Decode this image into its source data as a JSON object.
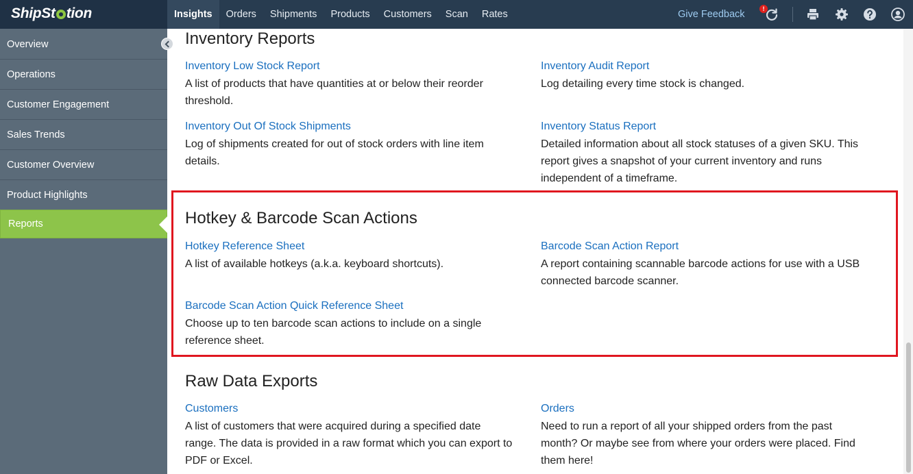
{
  "app": {
    "logo_left": "ShipSt",
    "logo_right": "tion"
  },
  "nav": {
    "items": [
      "Insights",
      "Orders",
      "Shipments",
      "Products",
      "Customers",
      "Scan",
      "Rates"
    ],
    "feedback": "Give Feedback",
    "notification_count": "!"
  },
  "sidebar": {
    "items": [
      "Overview",
      "Operations",
      "Customer Engagement",
      "Sales Trends",
      "Customer Overview",
      "Product Highlights",
      "Reports"
    ],
    "active": "Reports"
  },
  "sections": {
    "inventory": {
      "title": "Inventory Reports",
      "reports": [
        {
          "title": "Inventory Low Stock Report",
          "desc_lines": [
            "A list of products that have quantities at or below their reorder",
            "threshold."
          ]
        },
        {
          "title": "Inventory Audit Report",
          "desc_lines": [
            "Log detailing every time stock is changed."
          ]
        },
        {
          "title": "Inventory Out Of Stock Shipments",
          "desc_lines": [
            "Log of shipments created for out of stock orders with line item",
            "details."
          ]
        },
        {
          "title": "Inventory Status Report",
          "desc_lines": [
            "Detailed information about all stock statuses of a given SKU. This",
            "report gives a snapshot of your current inventory and runs",
            "independent of a timeframe."
          ]
        }
      ]
    },
    "hotkey": {
      "title": "Hotkey & Barcode Scan Actions",
      "reports": [
        {
          "title": "Hotkey Reference Sheet",
          "desc_lines": [
            "A list of available hotkeys (a.k.a. keyboard shortcuts)."
          ]
        },
        {
          "title": "Barcode Scan Action Report",
          "desc_lines": [
            "A report containing scannable barcode actions for use with a USB",
            "connected barcode scanner."
          ]
        },
        {
          "title": "Barcode Scan Action Quick Reference Sheet",
          "desc_lines": [
            "Choose up to ten barcode scan actions to include on a single",
            "reference sheet."
          ]
        }
      ]
    },
    "raw": {
      "title": "Raw Data Exports",
      "reports": [
        {
          "title": "Customers",
          "desc_lines": [
            "A list of customers that were acquired during a specified date",
            "range. The data is provided in a raw format which you can export to",
            "PDF or Excel."
          ]
        },
        {
          "title": "Orders",
          "desc_lines": [
            "Need to run a report of all your shipped orders from the past",
            "month? Or maybe see from where your orders were placed. Find",
            "them here!"
          ]
        }
      ]
    }
  },
  "colors": {
    "topbar": "#283c50",
    "sidebar": "#5b6b79",
    "active": "#8dc44a",
    "link": "#1a6fbf",
    "highlight": "#e0161f"
  },
  "icons": [
    "refresh-icon",
    "printer-icon",
    "gear-icon",
    "help-icon",
    "user-icon"
  ]
}
